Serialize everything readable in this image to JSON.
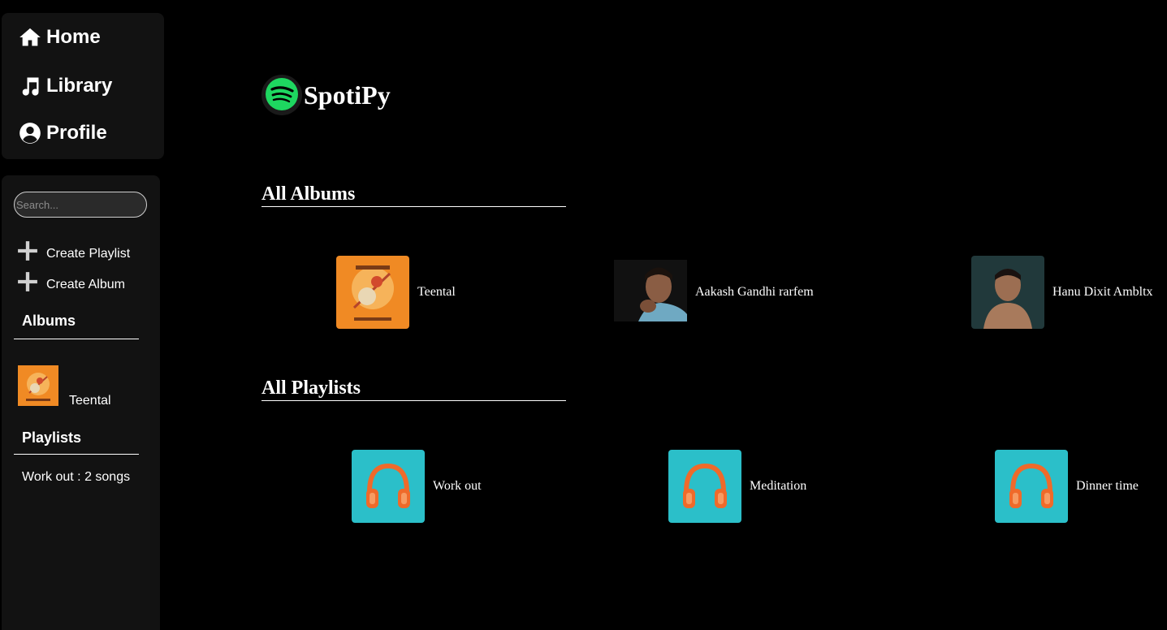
{
  "nav": {
    "items": [
      {
        "label": "Home",
        "icon": "home-icon"
      },
      {
        "label": "Library",
        "icon": "music-note-icon"
      },
      {
        "label": "Profile",
        "icon": "user-circle-icon"
      }
    ]
  },
  "library": {
    "search_placeholder": "Search...",
    "create_playlist": "Create Playlist",
    "create_album": "Create Album",
    "albums_heading": "Albums",
    "albums": [
      {
        "title": "Teental"
      }
    ],
    "playlists_heading": "Playlists",
    "playlists": [
      {
        "text": "Work out : 2 songs"
      }
    ]
  },
  "header": {
    "app_name": "SpotiPy",
    "logo_color": "#1ed760"
  },
  "main": {
    "albums_heading": "All Albums",
    "albums": [
      {
        "title": "Teental",
        "cover": "orange-art"
      },
      {
        "title": "Aakash Gandhi rarfem",
        "cover": "dark-portrait"
      },
      {
        "title": "Hanu Dixit Ambltx",
        "cover": "teal-portrait"
      }
    ],
    "playlists_heading": "All Playlists",
    "playlists": [
      {
        "title": "Work out",
        "cover": "headphones"
      },
      {
        "title": "Meditation",
        "cover": "headphones"
      },
      {
        "title": "Dinner time",
        "cover": "headphones"
      }
    ]
  },
  "colors": {
    "background": "#000000",
    "panel": "#121212",
    "accent": "#1ed760",
    "playlist_cover_bg": "#2bbfc9",
    "headphones": "#ef6a2a"
  }
}
